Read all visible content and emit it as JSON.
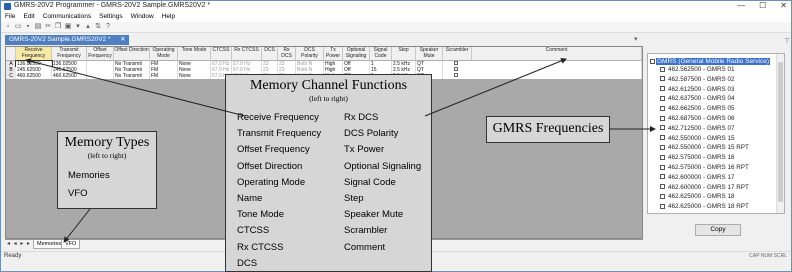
{
  "window": {
    "title": "GMRS-20V2 Programmer - GMRS-20V2 Sample.GMRS20V2 *",
    "controls": [
      "—",
      "☐",
      "✕"
    ]
  },
  "menu": [
    "File",
    "Edit",
    "Communications",
    "Settings",
    "Window",
    "Help"
  ],
  "doc_tab": {
    "label": "GMRS-20V2 Sample.GMRS20V2 *",
    "close": "✕"
  },
  "tab_dropdown": "▾",
  "pin": "⊤",
  "columns": [
    "Receive Frequency",
    "Transmit Frequency",
    "Offset Frequency",
    "Offset Direction",
    "Operating Mode",
    "Tone Mode",
    "CTCSS",
    "Rx CTCSS",
    "DCS",
    "Rx DCS",
    "DCS Polarity",
    "Tx Power",
    "Optional Signaling",
    "Signal Code",
    "Step",
    "Speaker Mute",
    "Scrambler",
    "Comment"
  ],
  "rows": [
    {
      "id": "A",
      "rx": "136.02500",
      "tx": "136.02500",
      "offdir": "No Transmit",
      "mode": "FM",
      "tone": "None",
      "ctcss": "67.0 Hz",
      "rxctcss": "67.0 Hz",
      "dcs": "23",
      "rxdcs": "23",
      "pol": "Both N",
      "power": "High",
      "opt": "Off",
      "sig": "1",
      "step": "2.5 kHz",
      "mute": "QT"
    },
    {
      "id": "B",
      "rx": "245.62500",
      "tx": "245.62500",
      "offdir": "No Transmit",
      "mode": "FM",
      "tone": "None",
      "ctcss": "67.0 Hz",
      "rxctcss": "67.0 Hz",
      "dcs": "23",
      "rxdcs": "23",
      "pol": "Both N",
      "power": "High",
      "opt": "Off",
      "sig": "15",
      "step": "2.5 kHz",
      "mute": "QT"
    },
    {
      "id": "C",
      "rx": "460.62500",
      "tx": "460.62500",
      "offdir": "No Transmit",
      "mode": "FM",
      "tone": "None",
      "ctcss": "67.0 Hz",
      "rxctcss": "67.0 Hz",
      "dcs": "23",
      "rxdcs": "23",
      "pol": "Both N",
      "power": "High",
      "opt": "Off",
      "sig": "1",
      "step": "2.5 kHz",
      "mute": "QT"
    }
  ],
  "sheet_tabs": {
    "nav": "◂ ◂ ▸ ▸",
    "tabs": [
      "Memories",
      "VFO"
    ]
  },
  "status": {
    "left": "Ready",
    "right": "CAP NUM SCRL"
  },
  "gmrs_panel": {
    "root": "GMRS (General Mobile Radio Service)",
    "items": [
      "462.562500 - GMRS 01",
      "462.587500 - GMRS 02",
      "462.612500 - GMRS 03",
      "462.637500 - GMRS 04",
      "462.662500 - GMRS 05",
      "462.687500 - GMRS 06",
      "462.712500 - GMRS 07",
      "462.550000 - GMRS 15",
      "462.550000 - GMRS 15 RPT",
      "462.575000 - GMRS 16",
      "462.575000 - GMRS 16 RPT",
      "462.600000 - GMRS 17",
      "462.600000 - GMRS 17 RPT",
      "462.625000 - GMRS 18",
      "462.625000 - GMRS 18 RPT"
    ],
    "copy_label": "Copy"
  },
  "callouts": {
    "channel": {
      "title": "Memory Channel Functions",
      "subtitle": "(left to right)",
      "col1": [
        "Receive Frequency",
        "Transmit Frequency",
        "Offset Frequency",
        "Offset Direction",
        "Operating Mode",
        "Name",
        "Tone Mode",
        "CTCSS",
        "Rx CTCSS",
        "DCS"
      ],
      "col2": [
        "Rx DCS",
        "DCS Polarity",
        "Tx Power",
        "Optional Signaling",
        "Signal Code",
        "Step",
        "Speaker Mute",
        "Scrambler",
        "Comment"
      ]
    },
    "types": {
      "title": "Memory Types",
      "subtitle": "(left to right)",
      "items": [
        "Memories",
        "VFO"
      ]
    },
    "gmrs": {
      "title": "GMRS Frequencies"
    }
  }
}
